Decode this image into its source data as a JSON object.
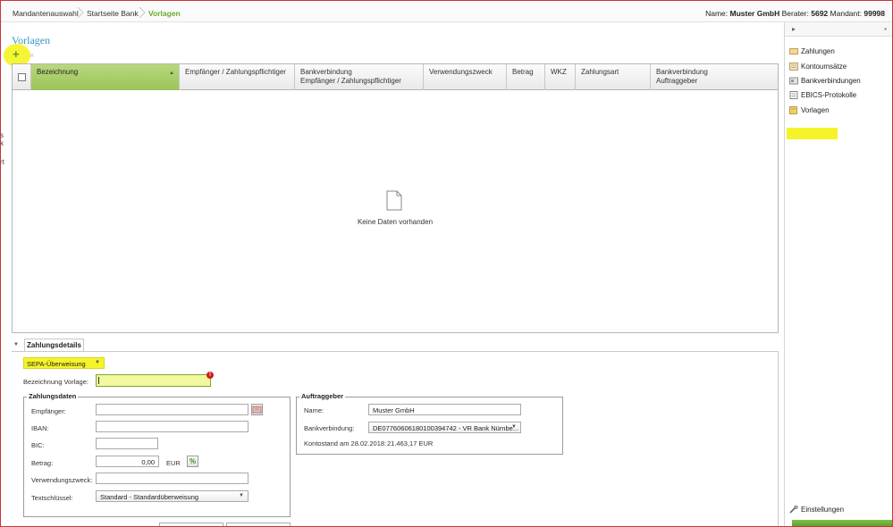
{
  "breadcrumb": {
    "items": [
      "Mandantenauswahl",
      "Startseite Bank",
      "Vorlagen"
    ]
  },
  "user_info": {
    "name_label": "Name:",
    "name_value": "Muster GmbH",
    "berater_label": "Berater:",
    "berater_value": "5692",
    "mandant_label": "Mandant:",
    "mandant_value": "99998"
  },
  "page": {
    "title": "Vorlagen",
    "add_icon": "+",
    "delete_icon": "×"
  },
  "grid": {
    "columns": [
      {
        "label": "Bezeichnung",
        "label2": ""
      },
      {
        "label": "Empfänger / Zahlungspflichtiger",
        "label2": ""
      },
      {
        "label": "Bankverbindung",
        "label2": "Empfänger / Zahlungspflichtiger"
      },
      {
        "label": "Verwendungszweck",
        "label2": ""
      },
      {
        "label": "Betrag",
        "label2": ""
      },
      {
        "label": "WKZ",
        "label2": ""
      },
      {
        "label": "Zahlungsart",
        "label2": ""
      },
      {
        "label": "Bankverbindung",
        "label2": "Auftraggeber"
      }
    ],
    "sort_arrow": "▲",
    "empty_text": "Keine Daten vorhanden"
  },
  "details": {
    "collapse_arrow": "▼",
    "tab_label": "Zahlungsdetails",
    "payment_type": "SEPA-Überweisung",
    "dropdown_arrow": "▼",
    "template_name_label": "Bezeichnung Vorlage:",
    "template_name_value": "",
    "error_badge": "!",
    "zahlungsdaten": {
      "legend": "Zahlungsdaten",
      "empfaenger_label": "Empfänger:",
      "empfaenger_value": "",
      "iban_label": "IBAN:",
      "iban_value": "",
      "bic_label": "BIC:",
      "bic_value": "",
      "betrag_label": "Betrag:",
      "betrag_value": "0,00",
      "currency": "EUR",
      "percent_icon": "%",
      "verwendungszweck_label": "Verwendungszweck:",
      "verwendungszweck_value": "",
      "textschluessel_label": "Textschlüssel:",
      "textschluessel_value": "Standard - Standardüberweisung"
    },
    "auftraggeber": {
      "legend": "Auftraggeber",
      "name_label": "Name:",
      "name_value": "Muster GmbH",
      "bank_label": "Bankverbindung:",
      "bank_value": "DE07760606180100394742 - VR Bank Nürnbe...",
      "kontostand_label": "Kontostand am 28.02.2018:",
      "kontostand_value": "21.463,17 EUR"
    }
  },
  "sidebar": {
    "collapse_icon": "▸",
    "pin_icon": "▪",
    "items": [
      {
        "label": "Zahlungen",
        "icon": "payments-icon"
      },
      {
        "label": "Kontoumsätze",
        "icon": "account-transactions-icon"
      },
      {
        "label": "Bankverbindungen",
        "icon": "bank-connections-icon"
      },
      {
        "label": "EBICS-Protokolle",
        "icon": "ebics-protocol-icon"
      },
      {
        "label": "Vorlagen",
        "icon": "templates-icon"
      }
    ],
    "settings_label": "Einstellungen"
  },
  "colors": {
    "accent_green": "#6aab2e",
    "title_blue": "#3399c4",
    "highlight_yellow": "#f5f42a",
    "error_red": "#d21d1d"
  }
}
